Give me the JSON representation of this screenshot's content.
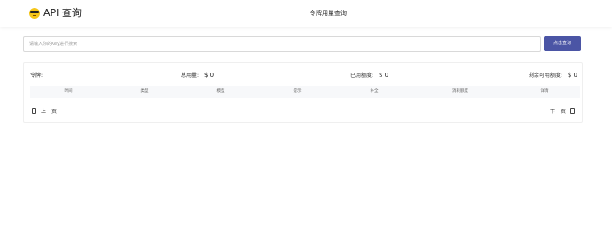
{
  "header": {
    "logo_icon": "sunglasses-face-icon",
    "app_title": "API 查询",
    "page_title": "令牌用量查询"
  },
  "search": {
    "placeholder": "请输入你的Key进行搜索",
    "value": "",
    "button_label": "点击查询",
    "button_color": "#4b55a5"
  },
  "stats": {
    "token_label": "令牌:",
    "token_value": "",
    "total_label": "总用量:",
    "total_value": "$ 0",
    "used_label": "已用额度:",
    "used_value": "$ 0",
    "remaining_label": "剩余可用额度:",
    "remaining_value": "$ 0"
  },
  "table": {
    "columns": [
      "时间",
      "类型",
      "模型",
      "提示",
      "补全",
      "消耗额度",
      "详情"
    ],
    "rows": []
  },
  "pagination": {
    "prev_label": "上一页",
    "next_label": "下一页",
    "prev_icon": "page-prev-icon",
    "next_icon": "page-next-icon"
  }
}
